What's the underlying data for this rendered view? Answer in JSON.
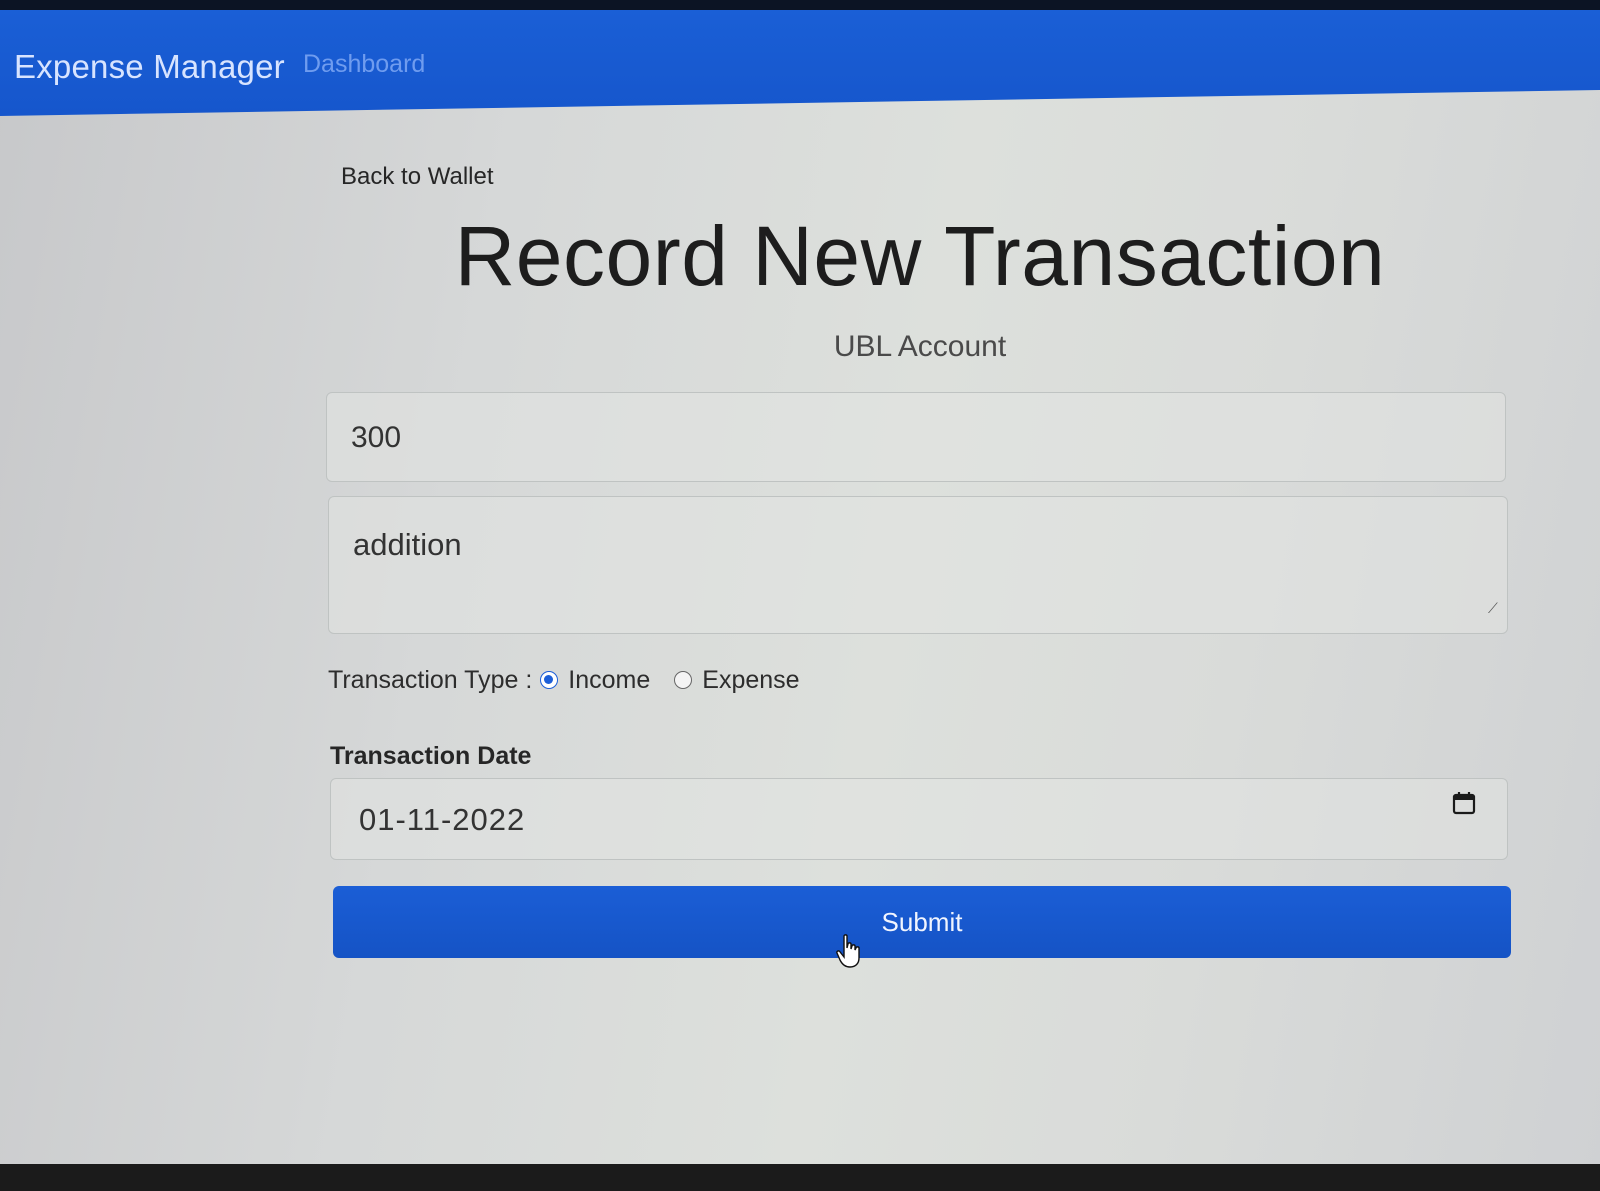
{
  "navbar": {
    "brand": "Expense Manager",
    "links": [
      "Dashboard"
    ]
  },
  "page": {
    "back_link": "Back to Wallet",
    "title": "Record New Transaction",
    "account": "UBL Account"
  },
  "form": {
    "amount": "300",
    "description": "addition",
    "transaction_type": {
      "label": "Transaction Type :",
      "options": [
        "Income",
        "Expense"
      ],
      "selected": "Income"
    },
    "date": {
      "label": "Transaction Date",
      "value": "01-11-2022"
    },
    "submit_label": "Submit"
  },
  "colors": {
    "primary": "#1b5ed6",
    "background": "#d8dad8"
  }
}
